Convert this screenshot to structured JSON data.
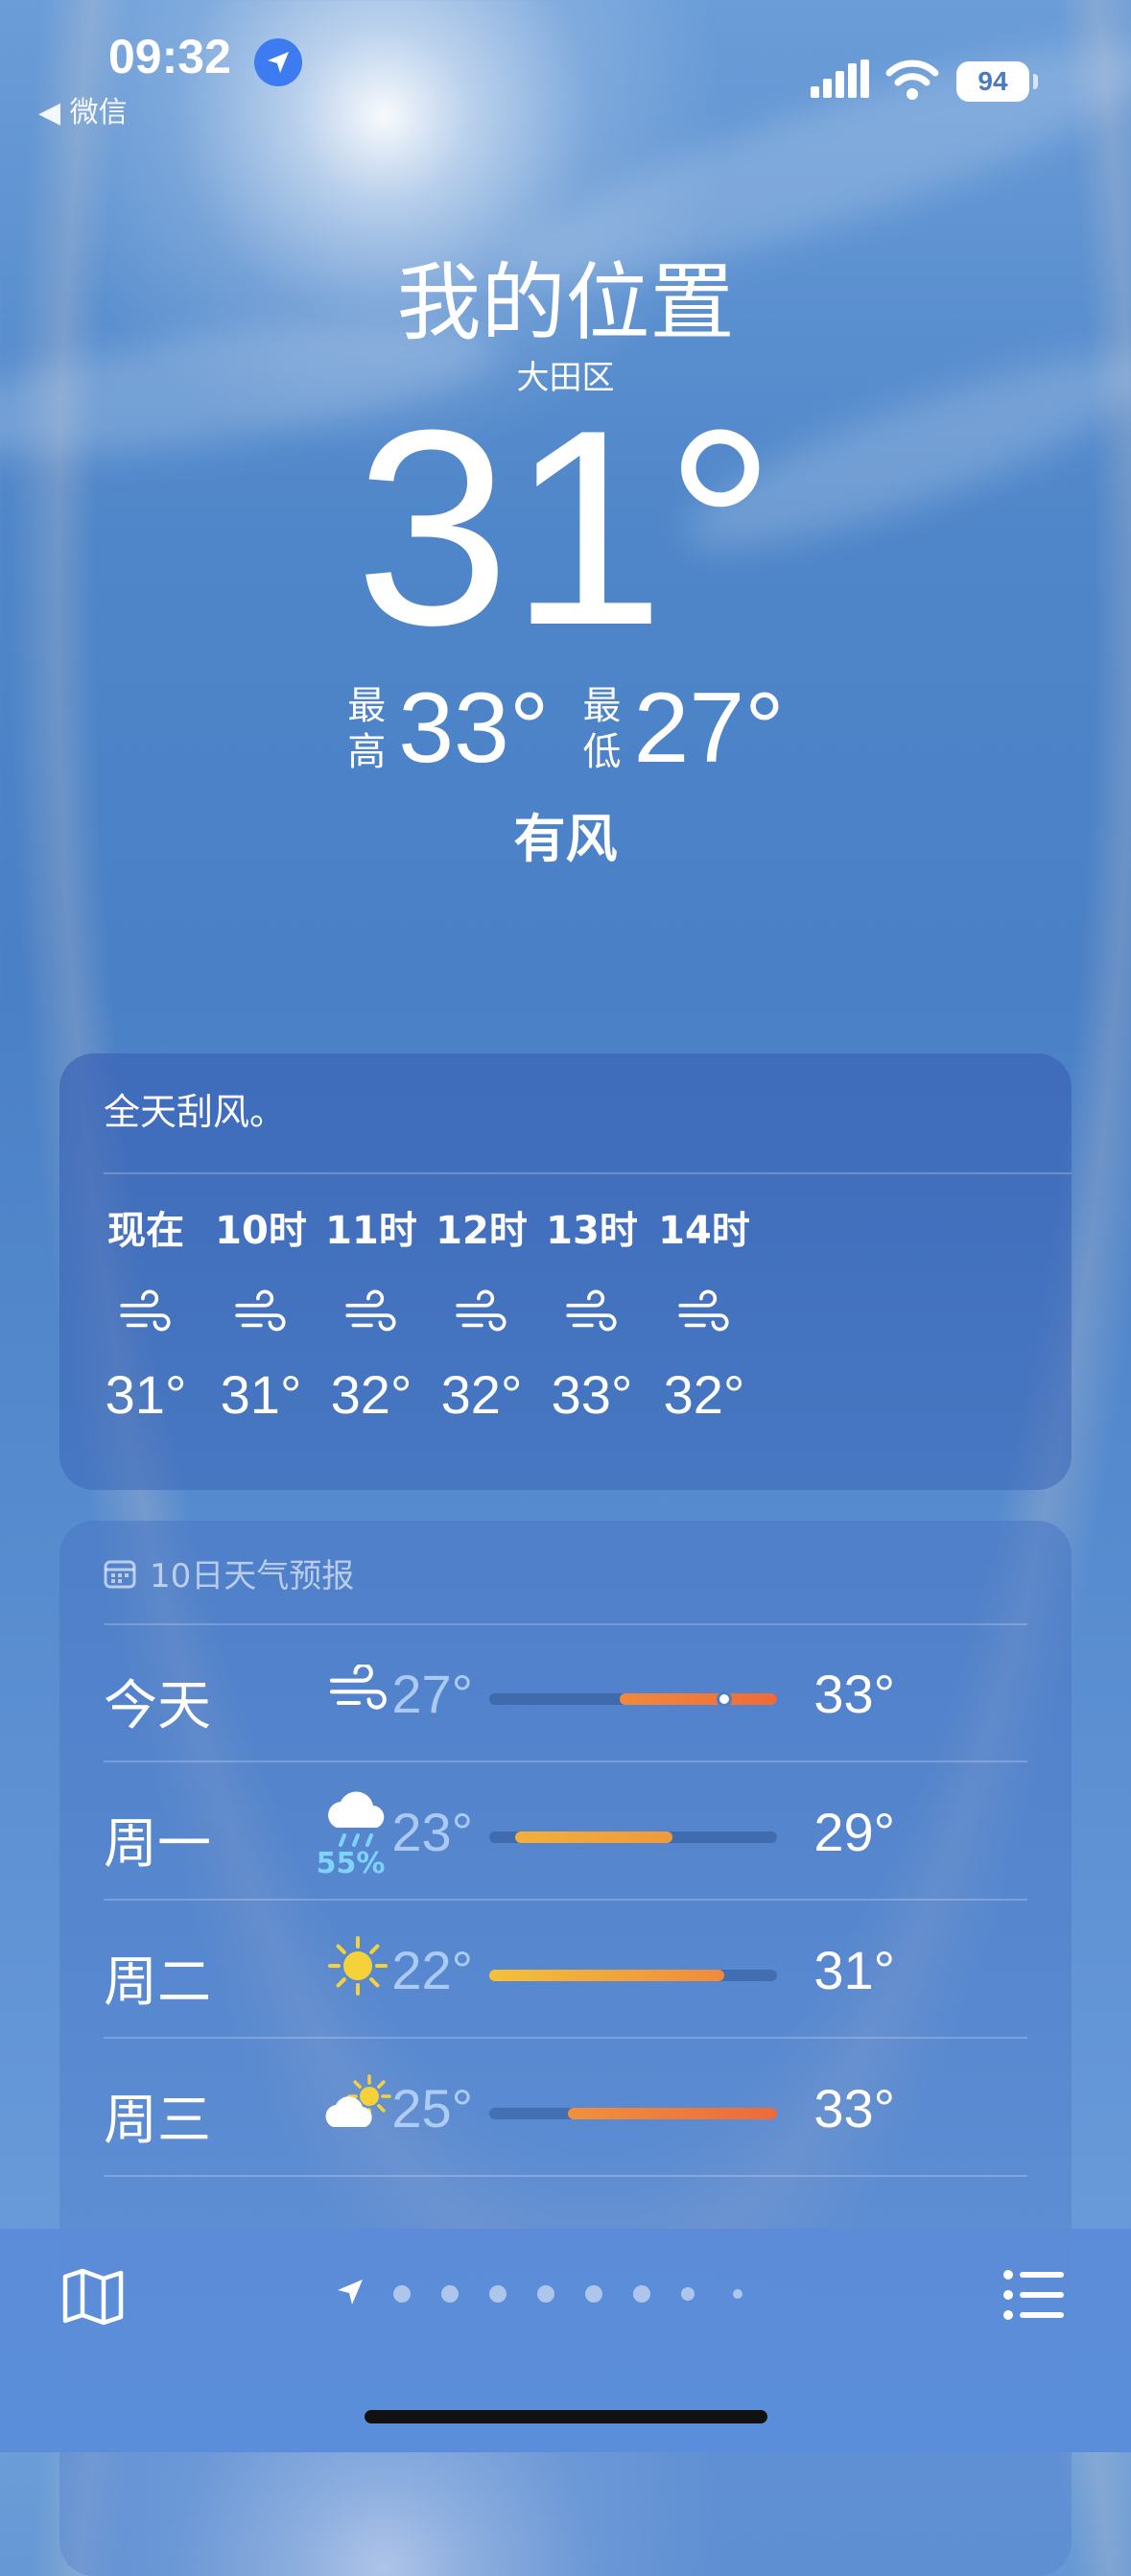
{
  "status_bar": {
    "time": "09:32",
    "back_label": "◀ 微信",
    "battery": "94"
  },
  "location": {
    "title": "我的位置",
    "district": "大田区",
    "current_temp": "31°",
    "high_label": "最高",
    "high": "33°",
    "low_label": "最低",
    "low": "27°",
    "condition": "有风"
  },
  "hourly": {
    "summary": "全天刮风。",
    "items": [
      {
        "hour": "现在",
        "icon": "wind-icon",
        "temp": "31°"
      },
      {
        "hour": "10时",
        "icon": "wind-icon",
        "temp": "31°"
      },
      {
        "hour": "11时",
        "icon": "wind-icon",
        "temp": "32°"
      },
      {
        "hour": "12时",
        "icon": "wind-icon",
        "temp": "32°"
      },
      {
        "hour": "13时",
        "icon": "wind-icon",
        "temp": "33°"
      },
      {
        "hour": "14时",
        "icon": "wind-icon",
        "temp": "32°"
      }
    ]
  },
  "daily": {
    "header": "10日天气预报",
    "range_min": 22,
    "range_max": 33,
    "current_temp_value": 31,
    "rows": [
      {
        "day": "今天",
        "icon": "wind-icon",
        "low": "27°",
        "high": "33°",
        "low_value": 27,
        "high_value": 33,
        "precip": "",
        "colors": [
          "#f08a3c",
          "#ef6a3a"
        ]
      },
      {
        "day": "周一",
        "icon": "rain-cloud-icon",
        "low": "23°",
        "high": "29°",
        "low_value": 23,
        "high_value": 29,
        "precip": "55%",
        "colors": [
          "#f2b03a",
          "#f09a3a"
        ]
      },
      {
        "day": "周二",
        "icon": "sun-icon",
        "low": "22°",
        "high": "31°",
        "low_value": 22,
        "high_value": 31,
        "precip": "",
        "colors": [
          "#f2c23a",
          "#f08a3c"
        ]
      },
      {
        "day": "周三",
        "icon": "partly-sunny-icon",
        "low": "25°",
        "high": "33°",
        "low_value": 25,
        "high_value": 33,
        "precip": "",
        "colors": [
          "#f0903c",
          "#ee6a3a"
        ]
      }
    ]
  },
  "bottom_bar": {
    "map_icon": "map-icon",
    "list_icon": "list-icon",
    "page_count": 9,
    "active_page": 0
  }
}
